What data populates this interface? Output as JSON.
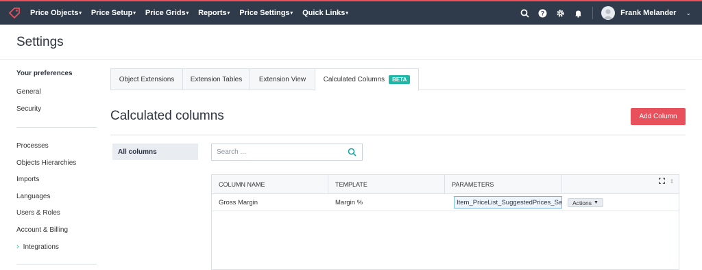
{
  "nav": {
    "items": [
      {
        "label": "Price Objects"
      },
      {
        "label": "Price Setup"
      },
      {
        "label": "Price Grids"
      },
      {
        "label": "Reports"
      },
      {
        "label": "Price Settings"
      },
      {
        "label": "Quick Links"
      }
    ],
    "user_name": "Frank Melander"
  },
  "page": {
    "title": "Settings"
  },
  "sidebar": {
    "heading": "Your preferences",
    "group1": [
      {
        "label": "General"
      },
      {
        "label": "Security"
      }
    ],
    "group2": [
      {
        "label": "Processes"
      },
      {
        "label": "Objects Hierarchies"
      },
      {
        "label": "Imports"
      },
      {
        "label": "Languages"
      },
      {
        "label": "Users & Roles"
      },
      {
        "label": "Account & Billing"
      },
      {
        "label": "Integrations"
      }
    ]
  },
  "tabs": [
    {
      "label": "Object Extensions"
    },
    {
      "label": "Extension Tables"
    },
    {
      "label": "Extension View"
    },
    {
      "label": "Calculated Columns",
      "badge": "BETA"
    }
  ],
  "main": {
    "title": "Calculated columns",
    "add_button": "Add Column",
    "filter_label": "All columns",
    "search_placeholder": "Search ..."
  },
  "table": {
    "columns": [
      "COLUMN NAME",
      "TEMPLATE",
      "PARAMETERS"
    ],
    "rows": [
      {
        "name": "Gross Margin",
        "template": "Margin %",
        "parameters": "Item_PriceList_SuggestedPrices_SalesPric",
        "actions": "Actions"
      }
    ]
  },
  "colors": {
    "brand": "#e8505b",
    "topbar": "#2f3b4b",
    "badge": "#1fb8a6"
  }
}
